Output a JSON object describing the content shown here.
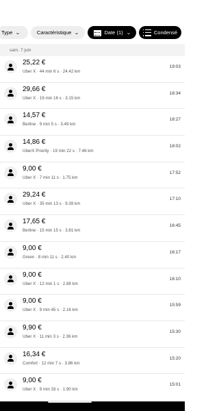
{
  "filters": {
    "type_label": "Type",
    "caracteristique_label": "Caractéristique",
    "date_label": "Date (1)",
    "condense_label": "Condensé"
  },
  "date_header": "sam. 7 juin",
  "trips": [
    {
      "price": "25,22 €",
      "details": "Uber X · 44 min 6 s · 24.42 km",
      "time": "19:03"
    },
    {
      "price": "29,66 €",
      "details": "Uber X · 19 min 16 s · 3.15 km",
      "time": "18:34"
    },
    {
      "price": "14,57 €",
      "details": "Berline · 9 min 5 s · 3.49 km",
      "time": "18:27"
    },
    {
      "price": "14,86 €",
      "details": "UberX Priority · 19 min 22 s · 7.46 km",
      "time": "18:02"
    },
    {
      "price": "9,00 €",
      "details": "Uber X · 7 min 11 s · 1.75 km",
      "time": "17:52"
    },
    {
      "price": "29,24 €",
      "details": "Uber X · 35 min 13 s · 9.39 km",
      "time": "17:10"
    },
    {
      "price": "17,65 €",
      "details": "Berline · 15 min 15 s · 3.81 km",
      "time": "16:45"
    },
    {
      "price": "9,00 €",
      "details": "Green · 8 min 11 s · 2.40 km",
      "time": "16:17"
    },
    {
      "price": "9,00 €",
      "details": "Uber X · 12 min 1 s · 2.88 km",
      "time": "16:10"
    },
    {
      "price": "9,00 €",
      "details": "Uber X · 9 min 45 s · 2.16 km",
      "time": "15:59"
    },
    {
      "price": "9,90 €",
      "details": "Uber X · 11 min 3 s · 2.36 km",
      "time": "15:30"
    },
    {
      "price": "16,34 €",
      "details": "Comfort · 12 min 7 s · 3.86 km",
      "time": "15:20"
    },
    {
      "price": "9,00 €",
      "details": "Uber X · 9 min 33 s · 1.90 km",
      "time": "15:01"
    }
  ]
}
